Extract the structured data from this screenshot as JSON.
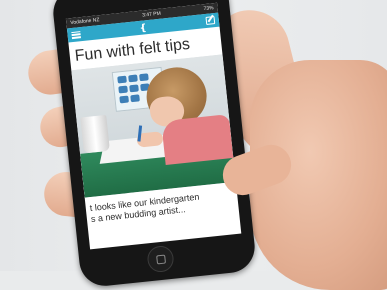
{
  "status_bar": {
    "carrier": "Vodafone NZ",
    "time": "3:47 PM",
    "battery": "73%"
  },
  "nav": {
    "menu_icon": "hamburger-menu-icon",
    "logo_icon": "app-logo-icon",
    "compose_icon": "compose-edit-icon",
    "accent_color": "#2ea7c9"
  },
  "post": {
    "title": "Fun with felt tips",
    "caption_line1": "t looks like our kindergarten",
    "caption_line2": "s a new budding artist..."
  }
}
